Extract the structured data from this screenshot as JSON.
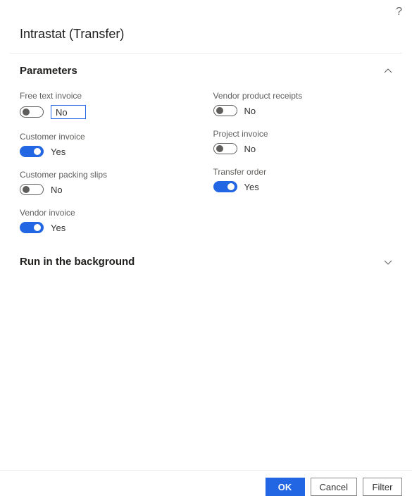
{
  "dialog": {
    "title": "Intrastat (Transfer)"
  },
  "sections": {
    "parameters": {
      "title": "Parameters"
    },
    "background": {
      "title": "Run in the background"
    }
  },
  "fields": {
    "free_text_invoice": {
      "label": "Free text invoice",
      "value": "No"
    },
    "customer_invoice": {
      "label": "Customer invoice",
      "value": "Yes"
    },
    "customer_packing_slips": {
      "label": "Customer packing slips",
      "value": "No"
    },
    "vendor_invoice": {
      "label": "Vendor invoice",
      "value": "Yes"
    },
    "vendor_product_receipts": {
      "label": "Vendor product receipts",
      "value": "No"
    },
    "project_invoice": {
      "label": "Project invoice",
      "value": "No"
    },
    "transfer_order": {
      "label": "Transfer order",
      "value": "Yes"
    }
  },
  "footer": {
    "ok": "OK",
    "cancel": "Cancel",
    "filter": "Filter"
  }
}
